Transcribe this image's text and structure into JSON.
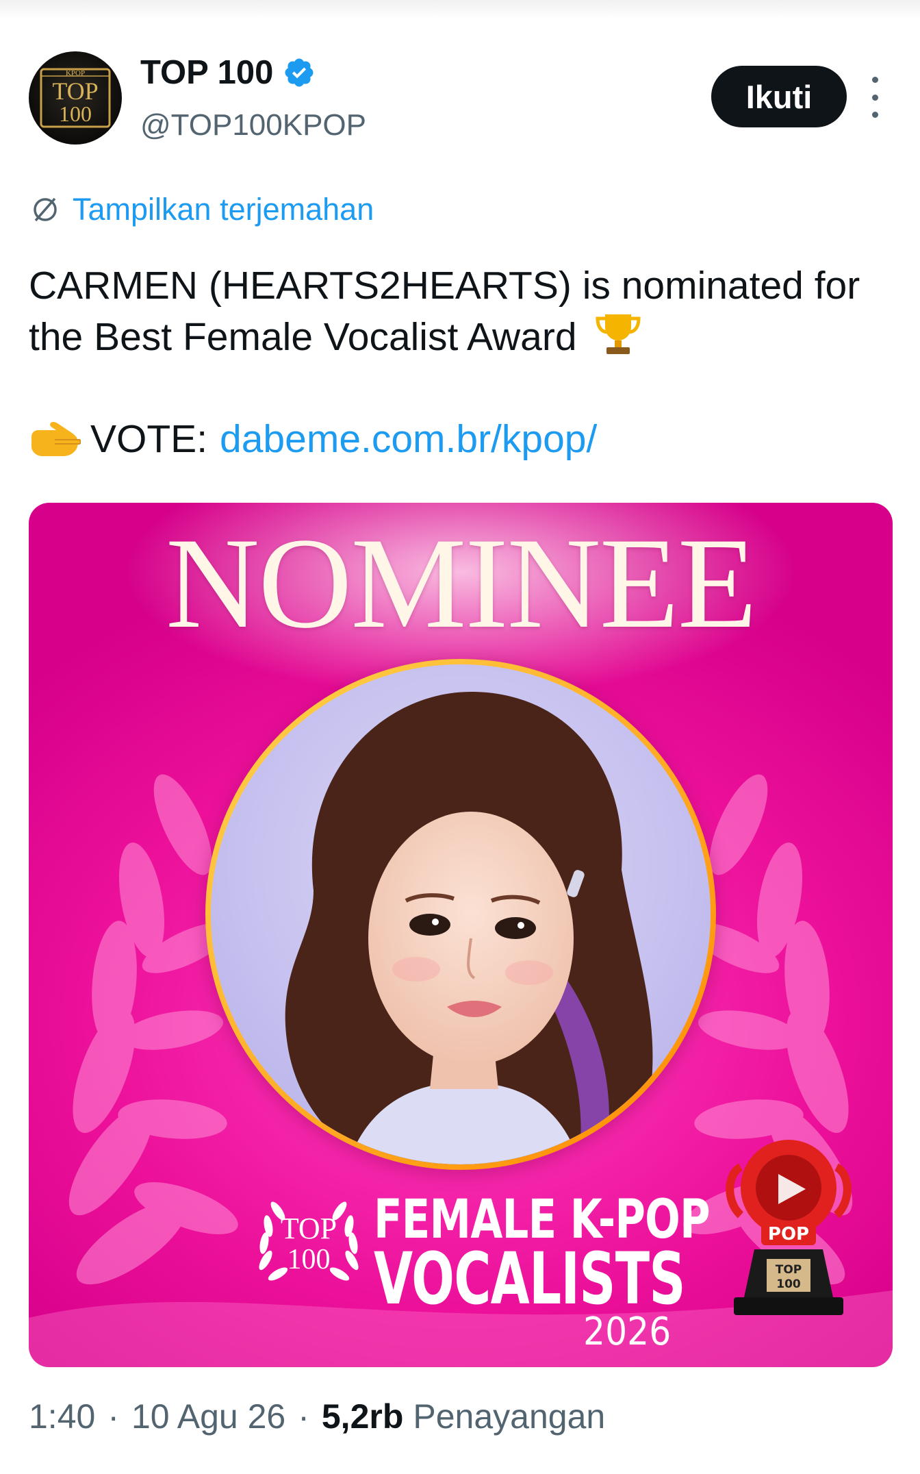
{
  "header": {
    "display_name": "TOP 100",
    "handle": "@TOP100KPOP",
    "follow_label": "Ikuti",
    "verified_icon": "verified-badge-icon",
    "avatar_logo_text": {
      "small": "KPOP",
      "big": "TOP",
      "num": "100"
    }
  },
  "translate": {
    "label": "Tampilkan terjemahan",
    "icon": "translate-globe-icon"
  },
  "tweet": {
    "text": "CARMEN (HEARTS2HEARTS) is nominated for the Best Female Vocalist Award",
    "trophy_emoji_icon": "trophy-icon",
    "vote_emoji_icon": "pointing-hand-icon",
    "vote_label": "VOTE:",
    "vote_link": "dabeme.com.br/kpop/"
  },
  "media": {
    "headline": "NOMINEE",
    "badge_top": "TOP",
    "badge_num": "100",
    "category_line1": "FEMALE K-POP",
    "category_line2": "VOCALISTS",
    "year": "2026",
    "trophy_pop": "POP",
    "trophy_top": "TOP",
    "trophy_num": "100",
    "colors": {
      "background": "#ec109a",
      "headline": "#fff6e8",
      "ring": "#ffb020"
    }
  },
  "meta": {
    "time": "1:40",
    "date": "10 Agu 26",
    "views_count": "5,2rb",
    "views_label": "Penayangan",
    "separator": "·"
  },
  "colors": {
    "link": "#1d9bf0",
    "text": "#0f1419",
    "muted": "#536471",
    "button": "#0f1419"
  }
}
